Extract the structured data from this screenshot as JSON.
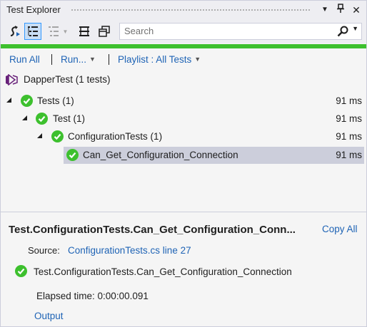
{
  "window": {
    "title": "Test Explorer"
  },
  "toolbar": {
    "search_placeholder": "Search"
  },
  "commands": {
    "run_all": "Run All",
    "run": "Run...",
    "playlist": "Playlist : All Tests"
  },
  "tree": {
    "project": "DapperTest (1 tests)",
    "rows": [
      {
        "label": "Tests (1)",
        "duration": "91 ms"
      },
      {
        "label": "Test (1)",
        "duration": "91 ms"
      },
      {
        "label": "ConfigurationTests (1)",
        "duration": "91 ms"
      },
      {
        "label": "Can_Get_Configuration_Connection",
        "duration": "91 ms"
      }
    ]
  },
  "details": {
    "title": "Test.ConfigurationTests.Can_Get_Configuration_Conn...",
    "copy_all": "Copy All",
    "source_label": "Source:",
    "source_link": "ConfigurationTests.cs line 27",
    "test_name": "Test.ConfigurationTests.Can_Get_Configuration_Connection",
    "elapsed": "Elapsed time: 0:00:00.091",
    "output": "Output"
  },
  "colors": {
    "pass_green": "#3dc02e",
    "link_blue": "#1e63b5",
    "selection": "#cccedb"
  }
}
